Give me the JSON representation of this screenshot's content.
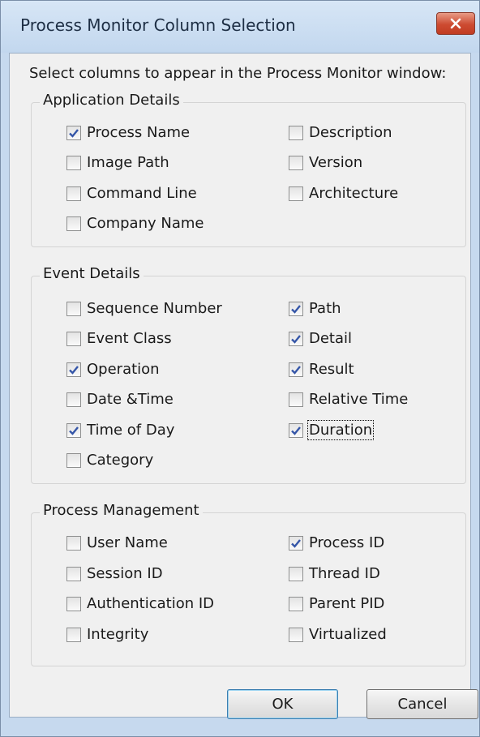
{
  "window": {
    "title": "Process Monitor Column Selection"
  },
  "instruction": "Select columns to appear in the Process Monitor window:",
  "groups": [
    {
      "label": "Application Details",
      "items": [
        {
          "label": "Process Name",
          "checked": true
        },
        {
          "label": "Description",
          "checked": false
        },
        {
          "label": "Image Path",
          "checked": false
        },
        {
          "label": "Version",
          "checked": false
        },
        {
          "label": "Command Line",
          "checked": false
        },
        {
          "label": "Architecture",
          "checked": false
        },
        {
          "label": "Company Name",
          "checked": false
        }
      ]
    },
    {
      "label": "Event Details",
      "items": [
        {
          "label": "Sequence Number",
          "checked": false
        },
        {
          "label": "Path",
          "checked": true
        },
        {
          "label": "Event Class",
          "checked": false
        },
        {
          "label": "Detail",
          "checked": true
        },
        {
          "label": "Operation",
          "checked": true
        },
        {
          "label": "Result",
          "checked": true
        },
        {
          "label": "Date &Time",
          "checked": false
        },
        {
          "label": "Relative Time",
          "checked": false
        },
        {
          "label": "Time of Day",
          "checked": true
        },
        {
          "label": "Duration",
          "checked": true,
          "focused": true
        },
        {
          "label": "Category",
          "checked": false
        }
      ]
    },
    {
      "label": "Process Management",
      "items": [
        {
          "label": "User Name",
          "checked": false
        },
        {
          "label": "Process ID",
          "checked": true
        },
        {
          "label": "Session ID",
          "checked": false
        },
        {
          "label": "Thread ID",
          "checked": false
        },
        {
          "label": "Authentication ID",
          "checked": false
        },
        {
          "label": "Parent PID",
          "checked": false
        },
        {
          "label": "Integrity",
          "checked": false
        },
        {
          "label": "Virtualized",
          "checked": false
        }
      ]
    }
  ],
  "buttons": {
    "ok": "OK",
    "cancel": "Cancel"
  },
  "icons": {
    "close": "close-icon",
    "checkmark": "checkmark-icon"
  },
  "colors": {
    "titlebar": "#c6d9ee",
    "close_button": "#c94a30",
    "checkmark": "#3556a8"
  }
}
